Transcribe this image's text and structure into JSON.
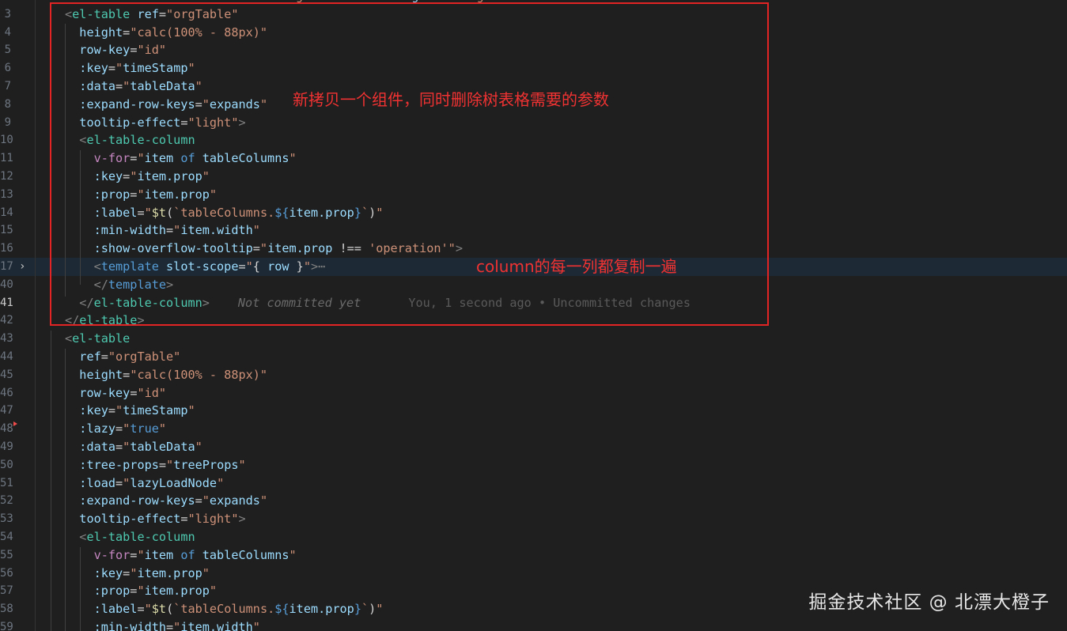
{
  "lines": [
    {
      "ln": "",
      "segs": [
        [
          "tag",
          "<el-table "
        ],
        [
          "attr",
          "v-if"
        ],
        [
          "plain",
          "="
        ],
        [
          "str",
          "\"activeName === 'orgTree'\" "
        ],
        [
          "attr",
          "v-loading"
        ],
        [
          "plain",
          "="
        ],
        [
          "str",
          "\"loading\""
        ],
        [
          "tagp",
          ">"
        ]
      ]
    },
    {
      "ln": "3",
      "segs": [
        [
          "tagp",
          "<"
        ],
        [
          "tag",
          "el-table "
        ],
        [
          "attr",
          "ref"
        ],
        [
          "plain",
          "="
        ],
        [
          "str",
          "\"orgTable\""
        ]
      ]
    },
    {
      "ln": "4",
      "segs": [
        [
          "plain",
          "  "
        ],
        [
          "attr",
          "height"
        ],
        [
          "plain",
          "="
        ],
        [
          "str",
          "\"calc(100% - 88px)\""
        ]
      ]
    },
    {
      "ln": "5",
      "segs": [
        [
          "plain",
          "  "
        ],
        [
          "attr",
          "row-key"
        ],
        [
          "plain",
          "="
        ],
        [
          "str",
          "\"id\""
        ]
      ]
    },
    {
      "ln": "6",
      "segs": [
        [
          "plain",
          "  "
        ],
        [
          "attr",
          ":key"
        ],
        [
          "plain",
          "="
        ],
        [
          "str",
          "\""
        ],
        [
          "id",
          "timeStamp"
        ],
        [
          "str",
          "\""
        ]
      ]
    },
    {
      "ln": "7",
      "segs": [
        [
          "plain",
          "  "
        ],
        [
          "attr",
          ":data"
        ],
        [
          "plain",
          "="
        ],
        [
          "str",
          "\""
        ],
        [
          "id",
          "tableData"
        ],
        [
          "str",
          "\""
        ]
      ]
    },
    {
      "ln": "8",
      "segs": [
        [
          "plain",
          "  "
        ],
        [
          "attr",
          ":expand-row-keys"
        ],
        [
          "plain",
          "="
        ],
        [
          "str",
          "\""
        ],
        [
          "id",
          "expands"
        ],
        [
          "str",
          "\""
        ]
      ]
    },
    {
      "ln": "9",
      "segs": [
        [
          "plain",
          "  "
        ],
        [
          "attr",
          "tooltip-effect"
        ],
        [
          "plain",
          "="
        ],
        [
          "str",
          "\"light\""
        ],
        [
          "tagp",
          ">"
        ]
      ]
    },
    {
      "ln": "10",
      "segs": [
        [
          "plain",
          "  "
        ],
        [
          "tagp",
          "<"
        ],
        [
          "tag",
          "el-table-column"
        ]
      ]
    },
    {
      "ln": "11",
      "segs": [
        [
          "plain",
          "    "
        ],
        [
          "ctl",
          "v-for"
        ],
        [
          "plain",
          "="
        ],
        [
          "str",
          "\""
        ],
        [
          "id",
          "item"
        ],
        [
          "kw",
          " of "
        ],
        [
          "id",
          "tableColumns"
        ],
        [
          "str",
          "\""
        ]
      ]
    },
    {
      "ln": "12",
      "segs": [
        [
          "plain",
          "    "
        ],
        [
          "attr",
          ":key"
        ],
        [
          "plain",
          "="
        ],
        [
          "str",
          "\""
        ],
        [
          "id",
          "item.prop"
        ],
        [
          "str",
          "\""
        ]
      ]
    },
    {
      "ln": "13",
      "segs": [
        [
          "plain",
          "    "
        ],
        [
          "attr",
          ":prop"
        ],
        [
          "plain",
          "="
        ],
        [
          "str",
          "\""
        ],
        [
          "id",
          "item.prop"
        ],
        [
          "str",
          "\""
        ]
      ]
    },
    {
      "ln": "14",
      "segs": [
        [
          "plain",
          "    "
        ],
        [
          "attr",
          ":label"
        ],
        [
          "plain",
          "="
        ],
        [
          "str",
          "\""
        ],
        [
          "fn",
          "$t"
        ],
        [
          "plain",
          "("
        ],
        [
          "str",
          "`tableColumns."
        ],
        [
          "kw",
          "${"
        ],
        [
          "id",
          "item.prop"
        ],
        [
          "kw",
          "}"
        ],
        [
          "str",
          "`"
        ],
        [
          "plain",
          ")"
        ],
        [
          "str",
          "\""
        ]
      ]
    },
    {
      "ln": "15",
      "segs": [
        [
          "plain",
          "    "
        ],
        [
          "attr",
          ":min-width"
        ],
        [
          "plain",
          "="
        ],
        [
          "str",
          "\""
        ],
        [
          "id",
          "item.width"
        ],
        [
          "str",
          "\""
        ]
      ]
    },
    {
      "ln": "16",
      "segs": [
        [
          "plain",
          "    "
        ],
        [
          "attr",
          ":show-overflow-tooltip"
        ],
        [
          "plain",
          "="
        ],
        [
          "str",
          "\""
        ],
        [
          "id",
          "item.prop"
        ],
        [
          "plain",
          " !== "
        ],
        [
          "str",
          "'operation'"
        ],
        [
          "str",
          "\""
        ],
        [
          "tagp",
          ">"
        ]
      ]
    },
    {
      "ln": "17",
      "segs": [
        [
          "plain",
          "    "
        ],
        [
          "tagp",
          "<"
        ],
        [
          "kw",
          "template "
        ],
        [
          "attr",
          "slot-scope"
        ],
        [
          "plain",
          "="
        ],
        [
          "str",
          "\""
        ],
        [
          "plain",
          "{ "
        ],
        [
          "id",
          "row"
        ],
        [
          "plain",
          " }"
        ],
        [
          "str",
          "\""
        ],
        [
          "tagp",
          ">"
        ],
        [
          "ellip",
          "⋯"
        ]
      ]
    },
    {
      "ln": "40",
      "segs": [
        [
          "plain",
          "    "
        ],
        [
          "tagp",
          "</"
        ],
        [
          "kw",
          "template"
        ],
        [
          "tagp",
          ">"
        ]
      ]
    },
    {
      "ln": "41",
      "segs": [
        [
          "plain",
          "  "
        ],
        [
          "tagp",
          "</"
        ],
        [
          "tag",
          "el-table-column"
        ],
        [
          "tagp",
          ">"
        ]
      ]
    },
    {
      "ln": "42",
      "segs": [
        [
          "tagp",
          "</"
        ],
        [
          "tag",
          "el-table"
        ],
        [
          "tagp",
          ">"
        ]
      ]
    },
    {
      "ln": "43",
      "segs": [
        [
          "tagp",
          "<"
        ],
        [
          "tag",
          "el-table"
        ]
      ]
    },
    {
      "ln": "44",
      "segs": [
        [
          "plain",
          "  "
        ],
        [
          "attr",
          "ref"
        ],
        [
          "plain",
          "="
        ],
        [
          "str",
          "\"orgTable\""
        ]
      ]
    },
    {
      "ln": "45",
      "segs": [
        [
          "plain",
          "  "
        ],
        [
          "attr",
          "height"
        ],
        [
          "plain",
          "="
        ],
        [
          "str",
          "\"calc(100% - 88px)\""
        ]
      ]
    },
    {
      "ln": "46",
      "segs": [
        [
          "plain",
          "  "
        ],
        [
          "attr",
          "row-key"
        ],
        [
          "plain",
          "="
        ],
        [
          "str",
          "\"id\""
        ]
      ]
    },
    {
      "ln": "47",
      "segs": [
        [
          "plain",
          "  "
        ],
        [
          "attr",
          ":key"
        ],
        [
          "plain",
          "="
        ],
        [
          "str",
          "\""
        ],
        [
          "id",
          "timeStamp"
        ],
        [
          "str",
          "\""
        ]
      ]
    },
    {
      "ln": "48",
      "segs": [
        [
          "plain",
          "  "
        ],
        [
          "attr",
          ":lazy"
        ],
        [
          "plain",
          "="
        ],
        [
          "str",
          "\""
        ],
        [
          "kw",
          "true"
        ],
        [
          "str",
          "\""
        ]
      ]
    },
    {
      "ln": "49",
      "segs": [
        [
          "plain",
          "  "
        ],
        [
          "attr",
          ":data"
        ],
        [
          "plain",
          "="
        ],
        [
          "str",
          "\""
        ],
        [
          "id",
          "tableData"
        ],
        [
          "str",
          "\""
        ]
      ]
    },
    {
      "ln": "50",
      "segs": [
        [
          "plain",
          "  "
        ],
        [
          "attr",
          ":tree-props"
        ],
        [
          "plain",
          "="
        ],
        [
          "str",
          "\""
        ],
        [
          "id",
          "treeProps"
        ],
        [
          "str",
          "\""
        ]
      ]
    },
    {
      "ln": "51",
      "segs": [
        [
          "plain",
          "  "
        ],
        [
          "attr",
          ":load"
        ],
        [
          "plain",
          "="
        ],
        [
          "str",
          "\""
        ],
        [
          "id",
          "lazyLoadNode"
        ],
        [
          "str",
          "\""
        ]
      ]
    },
    {
      "ln": "52",
      "segs": [
        [
          "plain",
          "  "
        ],
        [
          "attr",
          ":expand-row-keys"
        ],
        [
          "plain",
          "="
        ],
        [
          "str",
          "\""
        ],
        [
          "id",
          "expands"
        ],
        [
          "str",
          "\""
        ]
      ]
    },
    {
      "ln": "53",
      "segs": [
        [
          "plain",
          "  "
        ],
        [
          "attr",
          "tooltip-effect"
        ],
        [
          "plain",
          "="
        ],
        [
          "str",
          "\"light\""
        ],
        [
          "tagp",
          ">"
        ]
      ]
    },
    {
      "ln": "54",
      "segs": [
        [
          "plain",
          "  "
        ],
        [
          "tagp",
          "<"
        ],
        [
          "tag",
          "el-table-column"
        ]
      ]
    },
    {
      "ln": "55",
      "segs": [
        [
          "plain",
          "    "
        ],
        [
          "ctl",
          "v-for"
        ],
        [
          "plain",
          "="
        ],
        [
          "str",
          "\""
        ],
        [
          "id",
          "item"
        ],
        [
          "kw",
          " of "
        ],
        [
          "id",
          "tableColumns"
        ],
        [
          "str",
          "\""
        ]
      ]
    },
    {
      "ln": "56",
      "segs": [
        [
          "plain",
          "    "
        ],
        [
          "attr",
          ":key"
        ],
        [
          "plain",
          "="
        ],
        [
          "str",
          "\""
        ],
        [
          "id",
          "item.prop"
        ],
        [
          "str",
          "\""
        ]
      ]
    },
    {
      "ln": "57",
      "segs": [
        [
          "plain",
          "    "
        ],
        [
          "attr",
          ":prop"
        ],
        [
          "plain",
          "="
        ],
        [
          "str",
          "\""
        ],
        [
          "id",
          "item.prop"
        ],
        [
          "str",
          "\""
        ]
      ]
    },
    {
      "ln": "58",
      "segs": [
        [
          "plain",
          "    "
        ],
        [
          "attr",
          ":label"
        ],
        [
          "plain",
          "="
        ],
        [
          "str",
          "\""
        ],
        [
          "fn",
          "$t"
        ],
        [
          "plain",
          "("
        ],
        [
          "str",
          "`tableColumns."
        ],
        [
          "kw",
          "${"
        ],
        [
          "id",
          "item.prop"
        ],
        [
          "kw",
          "}"
        ],
        [
          "str",
          "`"
        ],
        [
          "plain",
          ")"
        ],
        [
          "str",
          "\""
        ]
      ]
    },
    {
      "ln": "59",
      "segs": [
        [
          "plain",
          "    "
        ],
        [
          "attr",
          ":min-width"
        ],
        [
          "plain",
          "="
        ],
        [
          "str",
          "\""
        ],
        [
          "id",
          "item.width"
        ],
        [
          "str",
          "\""
        ]
      ]
    }
  ],
  "blame": {
    "author_text": "Not committed yet",
    "detail_text": "You, 1 second ago • Uncommitted changes"
  },
  "annotations": {
    "note1": "新拷贝一个组件，同时删除树表格需要的参数",
    "note2": "column的每一列都复制一遍"
  },
  "watermark": "掘金技术社区 @ 北漂大橙子",
  "colors": {
    "annotation_red": "#e22424",
    "background": "#1f1f1f"
  }
}
